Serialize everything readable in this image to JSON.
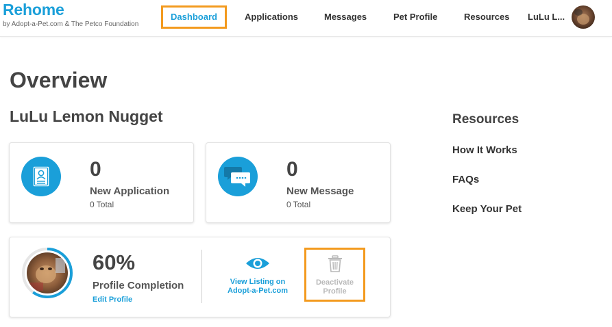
{
  "brand": {
    "title": "Rehome",
    "subtitle": "by Adopt-a-Pet.com & The Petco Foundation"
  },
  "nav": {
    "dashboard": "Dashboard",
    "applications": "Applications",
    "messages": "Messages",
    "pet_profile": "Pet Profile",
    "resources": "Resources",
    "user": "LuLu L..."
  },
  "page": {
    "title": "Overview",
    "pet_name": "LuLu Lemon Nugget"
  },
  "applications_card": {
    "count": "0",
    "label": "New Application",
    "total": "0 Total"
  },
  "messages_card": {
    "count": "0",
    "label": "New Message",
    "total": "0 Total"
  },
  "profile_card": {
    "completion_value": 0.6,
    "completion_text": "60%",
    "label": "Profile Completion",
    "edit_link": "Edit Profile",
    "view_listing_line1": "View Listing on",
    "view_listing_line2": "Adopt-a-Pet.com",
    "deactivate_line1": "Deactivate",
    "deactivate_line2": "Profile"
  },
  "resources": {
    "title": "Resources",
    "links": [
      "How It Works",
      "FAQs",
      "Keep Your Pet"
    ]
  },
  "colors": {
    "brand_blue": "#1a9fd9",
    "highlight_orange": "#f39a1e",
    "disabled_gray": "#b9b9b9"
  },
  "icons": {
    "applications": "document-person-icon",
    "messages": "chat-bubbles-icon",
    "view_listing": "eye-icon",
    "deactivate": "trash-icon"
  }
}
